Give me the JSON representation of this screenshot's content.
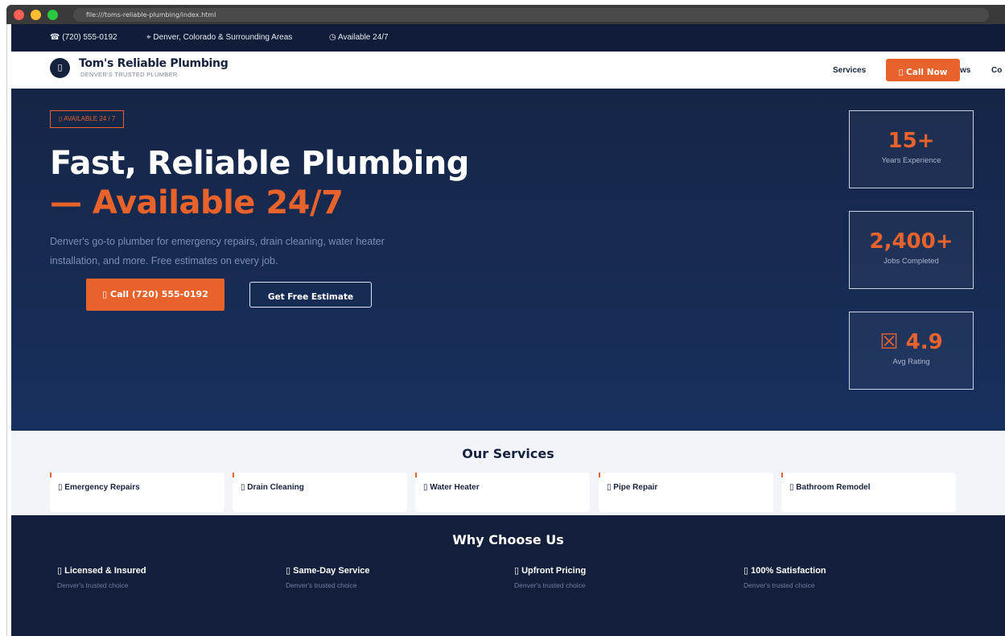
{
  "browser": {
    "url": "file:///toms-reliable-plumbing/index.html"
  },
  "topbar": {
    "phone": "☎ (720) 555-0192",
    "area": "⌖ Denver, Colorado & Surrounding Areas",
    "availability": "◷ Available 24/7"
  },
  "nav": {
    "logo_icon": "wrench-icon",
    "logo_glyph": "▯",
    "brand": "Tom's Reliable Plumbing",
    "tagline": "DENVER'S TRUSTED PLUMBER",
    "links": [
      "Services",
      "ws",
      "Co"
    ],
    "call_now": "▯ Call Now"
  },
  "hero": {
    "badge": "▯ AVAILABLE 24 / 7",
    "headline_1": "Fast, Reliable Plumbing",
    "headline_2": "— Available 24/7",
    "lead": "Denver's go-to plumber for emergency repairs, drain cleaning, water heater installation, and more. Free estimates on every job.",
    "call_button": "▯ Call (720) 555-0192",
    "estimate_button": "Get Free Estimate",
    "stats": [
      {
        "value": "15+",
        "label": "Years Experience"
      },
      {
        "value": "2,400+",
        "label": "Jobs Completed"
      },
      {
        "value": "☒ 4.9",
        "label": "Avg Rating"
      }
    ]
  },
  "services": {
    "title": "Our Services",
    "items": [
      "▯ Emergency Repairs",
      "▯ Drain Cleaning",
      "▯ Water Heater",
      "▯ Pipe Repair",
      "▯ Bathroom Remodel"
    ]
  },
  "why": {
    "title": "Why Choose Us",
    "items": [
      {
        "title": "▯ Licensed & Insured",
        "sub": "Denver's trusted choice"
      },
      {
        "title": "▯ Same-Day Service",
        "sub": "Denver's trusted choice"
      },
      {
        "title": "▯ Upfront Pricing",
        "sub": "Denver's trusted choice"
      },
      {
        "title": "▯ 100% Satisfaction",
        "sub": "Denver's trusted choice"
      }
    ]
  },
  "colors": {
    "accent": "#e8622c",
    "navy": "#131e3a",
    "hero_top": "#152546",
    "hero_bottom": "#18305e"
  }
}
